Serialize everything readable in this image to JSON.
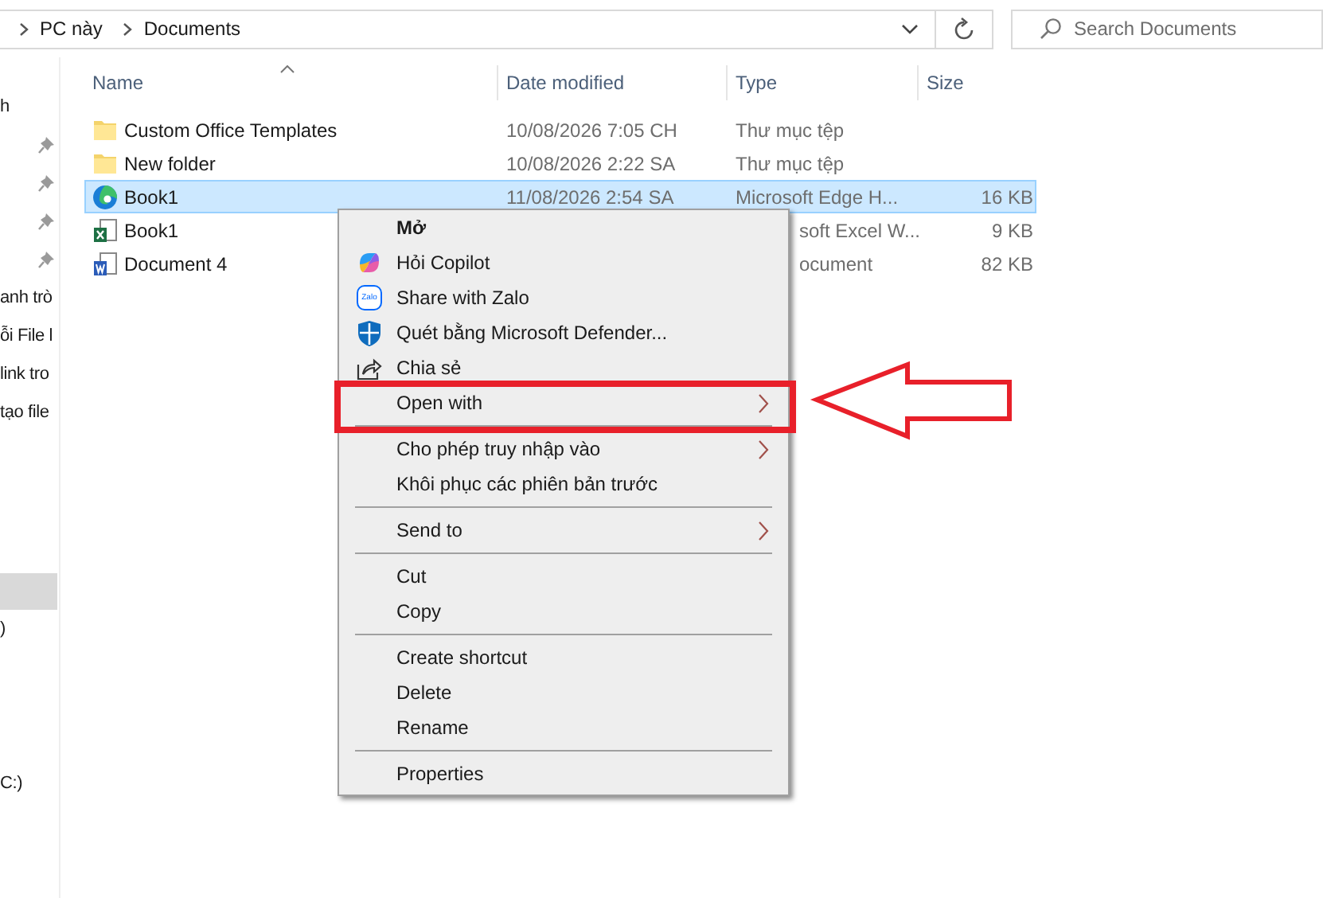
{
  "address_bar": {
    "breadcrumb": [
      "PC này",
      "Documents"
    ]
  },
  "search": {
    "placeholder": "Search Documents"
  },
  "sidebar": {
    "sections": [
      {
        "items": [
          {
            "label": "h",
            "pinned": false,
            "selected": false
          },
          {
            "pinned": true,
            "selected": false
          },
          {
            "pinned": true,
            "selected": false
          },
          {
            "pinned": true,
            "selected": false
          },
          {
            "pinned": true,
            "selected": false
          },
          {
            "label": "anh trò",
            "pinned": false,
            "selected": false
          },
          {
            "label": "ỗi File l",
            "pinned": false,
            "selected": false
          },
          {
            "label": "link tro",
            "pinned": false,
            "selected": false
          },
          {
            "label": "tạo file",
            "pinned": false,
            "selected": false
          }
        ]
      },
      {
        "items": [
          {
            "pinned": false,
            "selected": true
          },
          {
            "label": ")",
            "pinned": false,
            "selected": false
          }
        ]
      },
      {
        "items": [
          {
            "label": "C:)",
            "pinned": false,
            "selected": false
          }
        ]
      }
    ]
  },
  "table": {
    "columns": [
      "Name",
      "Date modified",
      "Type",
      "Size"
    ],
    "rows": [
      {
        "name": "Custom Office Templates",
        "date": "10/08/2026 7:05 CH",
        "type": "Thư mục tệp",
        "selected": false
      },
      {
        "name": "New folder",
        "date": "10/08/2026 2:22 SA",
        "type": "Thư mục tệp",
        "selected": false
      },
      {
        "name": "Book1",
        "date": "11/08/2026 2:54 SA",
        "type": "Microsoft Edge H...",
        "size": "16 KB",
        "selected": true
      },
      {
        "name": "Book1",
        "type": "soft Excel W...",
        "size": "9 KB",
        "selected": false
      },
      {
        "name": "Document 4",
        "type": "ocument",
        "size": "82 KB",
        "selected": false
      }
    ]
  },
  "context_menu": {
    "items": [
      {
        "kind": "item",
        "label": "Mở",
        "default": true
      },
      {
        "kind": "item",
        "label": "Hỏi Copilot"
      },
      {
        "kind": "item",
        "label": "Share with Zalo",
        "icon_text": "Zalo"
      },
      {
        "kind": "item",
        "label": "Quét bằng Microsoft Defender..."
      },
      {
        "kind": "item",
        "label": "Chia sẻ"
      },
      {
        "kind": "item",
        "label": "Open with",
        "submenu": true
      },
      {
        "kind": "separator"
      },
      {
        "kind": "item",
        "label": "Cho phép truy nhập vào",
        "submenu": true
      },
      {
        "kind": "item",
        "label": "Khôi phục các phiên bản trước"
      },
      {
        "kind": "separator"
      },
      {
        "kind": "item",
        "label": "Send to",
        "submenu": true
      },
      {
        "kind": "separator"
      },
      {
        "kind": "item",
        "label": "Cut"
      },
      {
        "kind": "item",
        "label": "Copy"
      },
      {
        "kind": "separator"
      },
      {
        "kind": "item",
        "label": "Create shortcut"
      },
      {
        "kind": "item",
        "label": "Delete"
      },
      {
        "kind": "item",
        "label": "Rename"
      },
      {
        "kind": "separator"
      },
      {
        "kind": "item",
        "label": "Properties"
      }
    ]
  }
}
